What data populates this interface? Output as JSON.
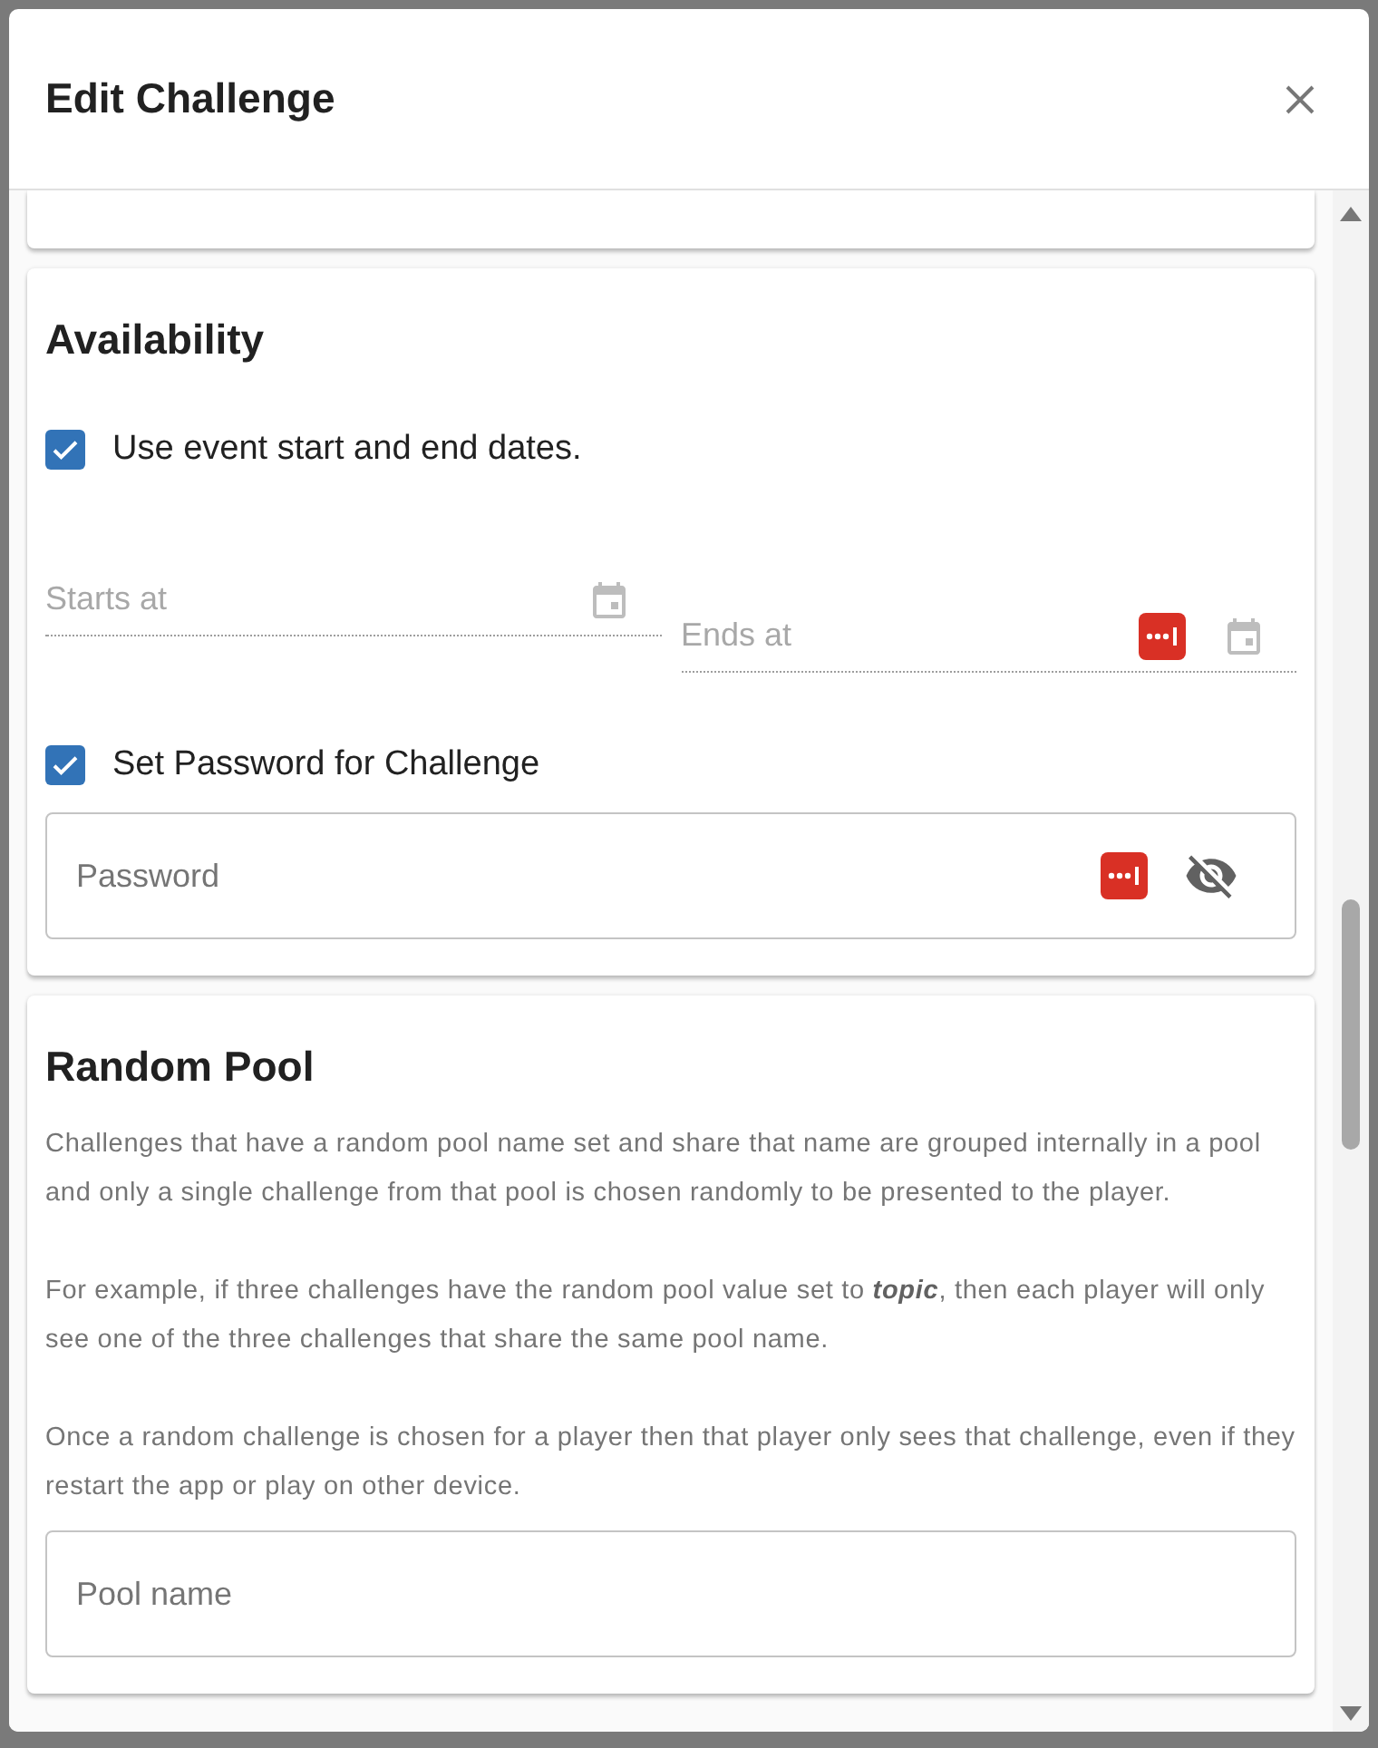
{
  "dialog": {
    "title": "Edit Challenge"
  },
  "availability": {
    "heading": "Availability",
    "use_event_dates": {
      "label": "Use event start and end dates.",
      "checked": true
    },
    "starts_at": {
      "placeholder": "Starts at"
    },
    "ends_at": {
      "placeholder": "Ends at"
    },
    "set_password": {
      "label": "Set Password for Challenge",
      "checked": true
    },
    "password": {
      "placeholder": "Password"
    }
  },
  "random_pool": {
    "heading": "Random Pool",
    "paragraphs": [
      "Challenges that have a random pool name set and share that name are grouped internally in a pool and only a single challenge from that pool is chosen randomly to be presented to the player.",
      "For example, if three challenges have the random pool value set to **topic**, then each player will only see one of the three challenges that share the same pool name.",
      "Once a random challenge is chosen for a player then that player only sees that challenge, even if they restart the app or play on other device."
    ],
    "pool_name": {
      "placeholder": "Pool name"
    }
  }
}
